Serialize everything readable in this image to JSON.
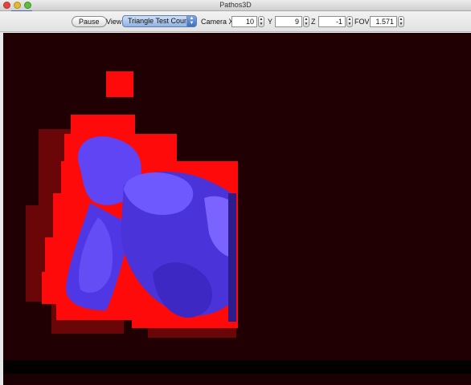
{
  "window": {
    "title": "Pathos3D"
  },
  "toolbar": {
    "pause_label": "Pause",
    "view_label": "View",
    "view_selected": "Triangle Test Count",
    "camera_x_label": "Camera X",
    "camera_x_value": "10",
    "y_label": "Y",
    "y_value": "9",
    "z_label": "Z",
    "z_value": "-1",
    "fov_label": "FOV",
    "fov_value": "1.571"
  },
  "colors": {
    "background": "#200003",
    "heat_high": "#ff0a0a",
    "heat_mid": "#7a0508",
    "mesh": "#5a3cf0"
  },
  "icons": {
    "close": "close-icon",
    "minimize": "minimize-icon",
    "zoom": "zoom-icon",
    "select_arrow": "chevron-updown-icon",
    "stepper": "stepper-icon"
  }
}
